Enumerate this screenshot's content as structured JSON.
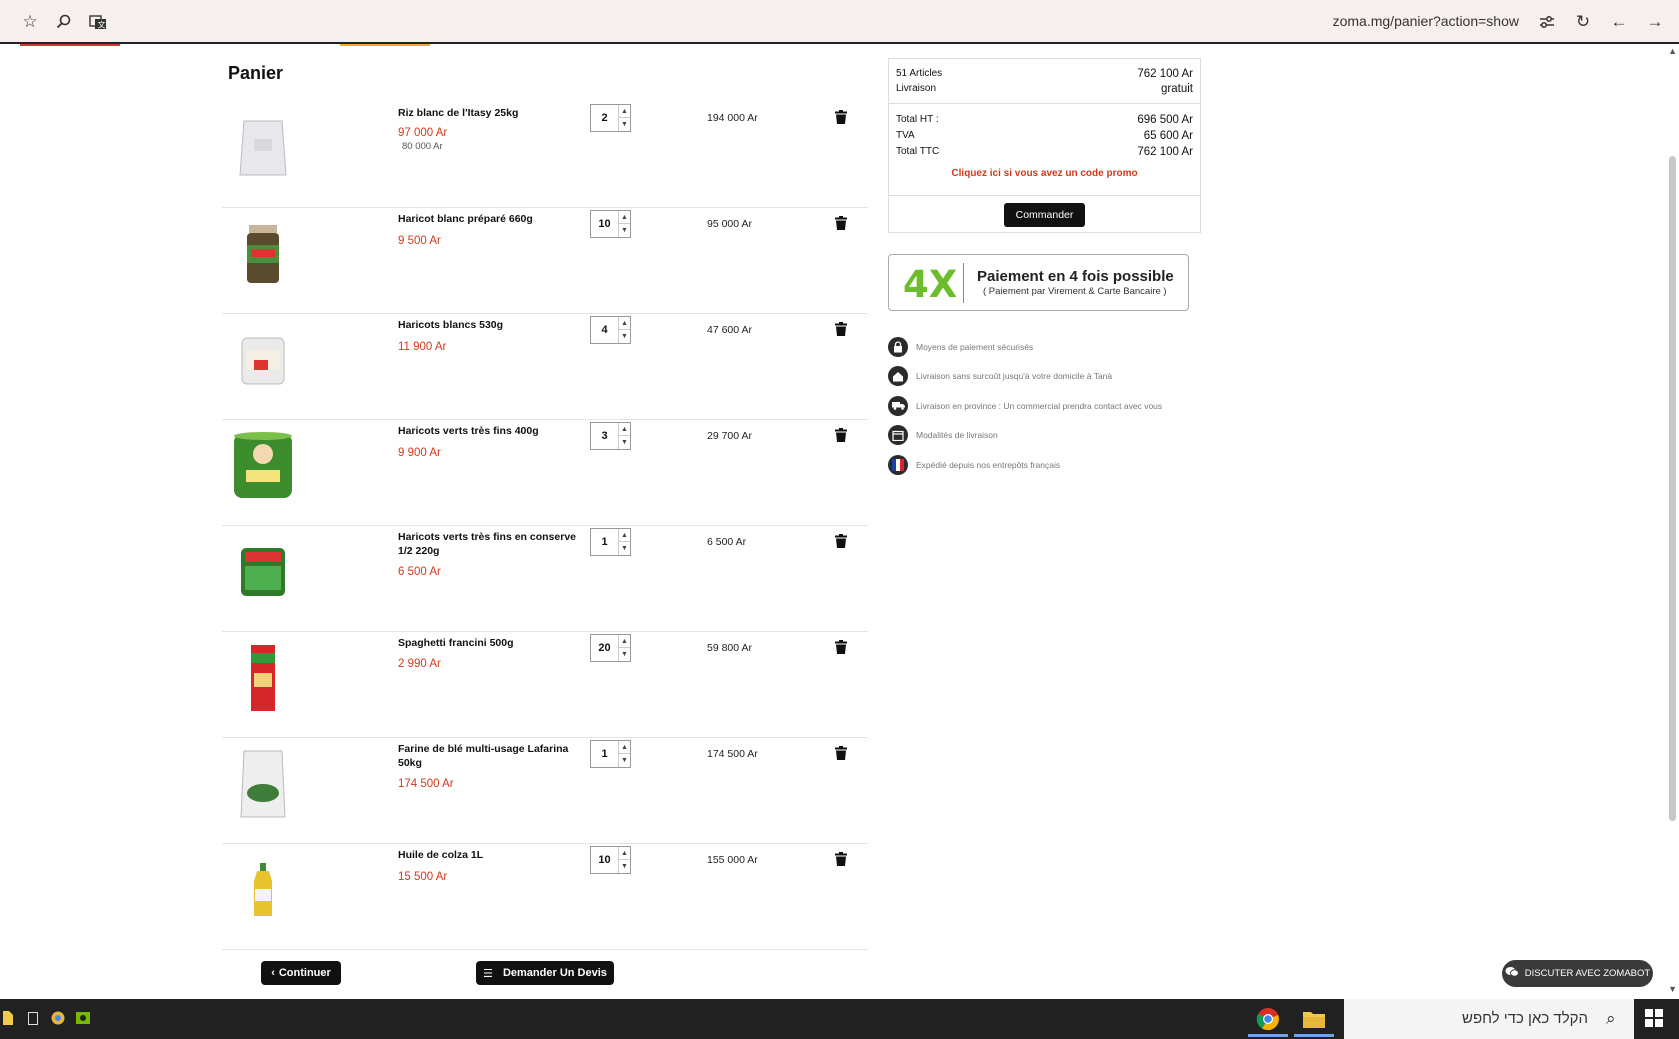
{
  "browser": {
    "url": "zoma.mg/panier?action=show",
    "icons": [
      "star-icon",
      "search-icon",
      "translate-icon",
      "site-settings-icon",
      "reload-icon",
      "back-icon",
      "forward-icon"
    ]
  },
  "cart": {
    "title": "Panier",
    "items": [
      {
        "name": "Riz blanc de l'Itasy 25kg",
        "price": "97 000 Ar",
        "old_price": "80 000 Ar",
        "qty": "2",
        "total": "194 000 Ar"
      },
      {
        "name": "Haricot blanc préparé 660g",
        "price": "9 500 Ar",
        "qty": "10",
        "total": "95 000 Ar"
      },
      {
        "name": "Haricots blancs 530g",
        "price": "11 900 Ar",
        "qty": "4",
        "total": "47 600 Ar"
      },
      {
        "name": "Haricots verts très fins 400g",
        "price": "9 900 Ar",
        "qty": "3",
        "total": "29 700 Ar"
      },
      {
        "name": "Haricots verts très fins en conserve 1/2 220g",
        "price": "6 500 Ar",
        "qty": "1",
        "total": "6 500 Ar"
      },
      {
        "name": "Spaghetti francini 500g",
        "price": "2 990 Ar",
        "qty": "20",
        "total": "59 800 Ar"
      },
      {
        "name": "Farine de blé multi-usage Lafarina 50kg",
        "price": "174 500 Ar",
        "qty": "1",
        "total": "174 500 Ar"
      },
      {
        "name": "Huile de colza 1L",
        "price": "15 500 Ar",
        "qty": "10",
        "total": "155 000 Ar"
      }
    ],
    "continue_label": "Continuer",
    "devis_label": "Demander Un Devis"
  },
  "summary": {
    "articles_label": "51 Articles",
    "articles_value": "762 100 Ar",
    "livraison_label": "Livraison",
    "livraison_value": "gratuit",
    "ht_label": "Total HT :",
    "ht_value": "696 500 Ar",
    "tva_label": "TVA",
    "tva_value": "65 600 Ar",
    "ttc_label": "Total TTC",
    "ttc_value": "762 100 Ar",
    "promo_text": "Cliquez ici si vous avez un code promo",
    "order_label": "Commander"
  },
  "payment_banner": {
    "big": "4X",
    "title": "Paiement en 4 fois possible",
    "subtitle": "( Paiement par Virement & Carte Bancaire )"
  },
  "features": [
    {
      "icon": "lock-icon",
      "text": "Moyens de paiement sécurisés"
    },
    {
      "icon": "home-icon",
      "text": "Livraison sans surcoût jusqu'à votre domicile à Tanà"
    },
    {
      "icon": "truck-icon",
      "text": "Livraison en province : Un commercial prendra contact avec vous"
    },
    {
      "icon": "calendar-icon",
      "text": "Modalités de livraison"
    },
    {
      "icon": "france-flag-icon",
      "text": "Expédié depuis nos entrepôts français"
    }
  ],
  "chatbot": {
    "label": "DISCUTER AVEC ZOMABOT"
  },
  "taskbar": {
    "search_placeholder": "הקלד כאן כדי לחפש"
  }
}
